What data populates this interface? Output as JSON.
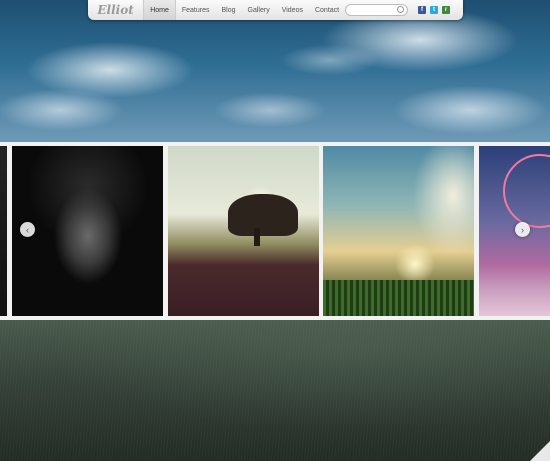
{
  "logo": {
    "text": "Elliot"
  },
  "nav": {
    "items": [
      {
        "label": "Home",
        "active": true
      },
      {
        "label": "Features",
        "active": false
      },
      {
        "label": "Blog",
        "active": false
      },
      {
        "label": "Gallery",
        "active": false
      },
      {
        "label": "Videos",
        "active": false
      },
      {
        "label": "Contact",
        "active": false
      }
    ]
  },
  "social": {
    "icons": [
      "facebook-icon",
      "twitter-icon",
      "rss-icon"
    ]
  },
  "slider": {
    "prev_symbol": "‹",
    "next_symbol": "›"
  }
}
